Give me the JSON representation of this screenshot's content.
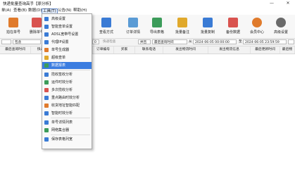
{
  "window": {
    "title": "快递批量查询高手【原分析】",
    "minimize": "—",
    "close": "✕"
  },
  "menubar": {
    "items": [
      "单(A)",
      "查看(B)",
      "数据(D)",
      "工具(T)",
      "公告(N)",
      "帮助(H)"
    ]
  },
  "toolbar": {
    "buttons": [
      {
        "label": "拍在单号",
        "icon": "edit-icon",
        "color": "#e07b2c"
      },
      {
        "label": "删除单号",
        "icon": "delete-icon",
        "color": "#d9534f"
      },
      {
        "label": "",
        "icon": "data-icon",
        "color": "#c9a63a"
      },
      {
        "label": "查看方式",
        "icon": "view-icon",
        "color": "#3a7bd5"
      },
      {
        "label": "订单详情",
        "icon": "detail-icon",
        "color": "#5a9bd5"
      },
      {
        "label": "导出表格",
        "icon": "export-icon",
        "color": "#3c9c5a"
      },
      {
        "label": "批量备注",
        "icon": "note-icon",
        "color": "#e0a92c"
      },
      {
        "label": "批量复制",
        "icon": "copy-icon",
        "color": "#3a7bd5"
      },
      {
        "label": "备份数据",
        "icon": "backup-icon",
        "color": "#d9534f"
      },
      {
        "label": "会员中心",
        "icon": "member-icon",
        "color": "#e07b2c"
      },
      {
        "label": "高级设置",
        "icon": "settings-icon",
        "color": "#6a6a6a"
      }
    ]
  },
  "filterbar": {
    "select1": "包含",
    "input1": "0",
    "check_label": "快递检查",
    "select2": "并且",
    "select3": "最后查询时间",
    "from_label": "从",
    "from_value": "2024-06-05 00:00:00",
    "to_label": "至",
    "to_value": "2024-06-05 23:59:59"
  },
  "columns": [
    "最后查询时间",
    "快递",
    "",
    "订单编号",
    "买家",
    "联系电话",
    "发出物流时间",
    "发出物流信息",
    "最后更新时间",
    "最后物"
  ],
  "dropdown": {
    "items": [
      {
        "label": "高级设置",
        "color": "#3a7bd5"
      },
      {
        "label": "智能查单设置",
        "color": "#3a7bd5"
      },
      {
        "label": "ADSL宽带号设置",
        "color": "#3a7bd5"
      },
      {
        "label": "代理IP设置",
        "color": "#3a7bd5"
      },
      {
        "label": "单号生成器",
        "color": "#e07b2c"
      },
      {
        "label": "超级查单",
        "color": "#e0a92c"
      },
      {
        "label": "数据报表",
        "color": "#3c9c5a",
        "highlighted": true
      },
      {
        "label": "揽收签收分析",
        "color": "#3a7bd5"
      },
      {
        "label": "运件时效分析",
        "color": "#3c9c5a"
      },
      {
        "label": "多次揽收分析",
        "color": "#d9534f"
      },
      {
        "label": "重点路由时效分析",
        "color": "#3a7bd5"
      },
      {
        "label": "收货地址智能匹配",
        "color": "#e07b2c"
      },
      {
        "label": "智能时效分析",
        "color": "#3a7bd5"
      },
      {
        "label": "单号详情列表",
        "color": "#3a7bd5"
      },
      {
        "label": "网络集合器",
        "color": "#3c9c5a"
      },
      {
        "label": "保存表格列宽",
        "color": "#3a7bd5"
      }
    ]
  }
}
